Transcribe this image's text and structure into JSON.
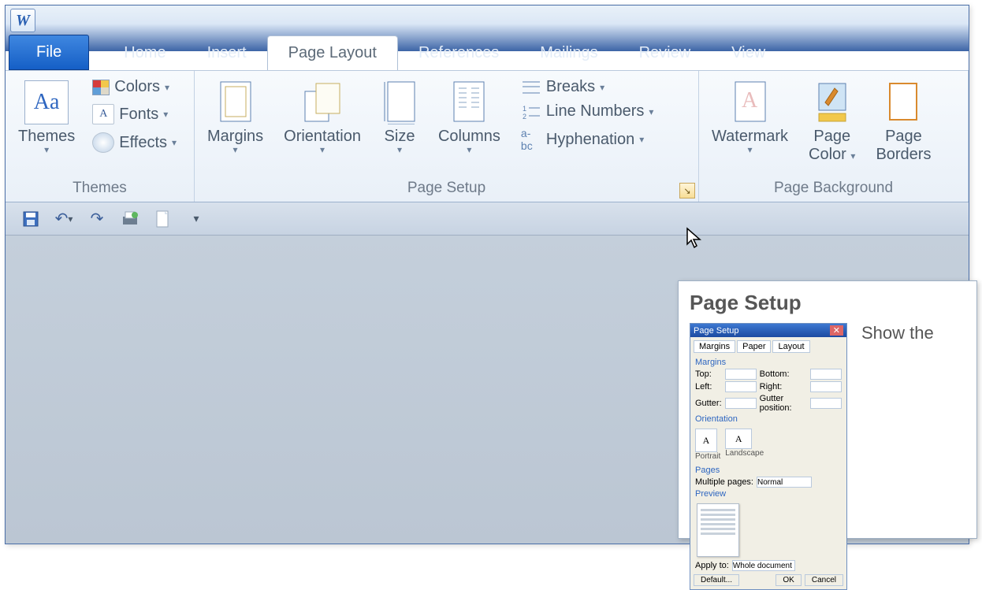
{
  "app_icon_letter": "W",
  "tabs": {
    "file": "File",
    "home": "Home",
    "insert": "Insert",
    "page_layout": "Page Layout",
    "references": "References",
    "mailings": "Mailings",
    "review": "Review",
    "view": "View"
  },
  "groups": {
    "themes": {
      "label": "Themes",
      "themes_btn": "Themes",
      "colors": "Colors",
      "fonts": "Fonts",
      "effects": "Effects"
    },
    "page_setup": {
      "label": "Page Setup",
      "margins": "Margins",
      "orientation": "Orientation",
      "size": "Size",
      "columns": "Columns",
      "breaks": "Breaks",
      "line_numbers": "Line Numbers",
      "hyphenation": "Hyphenation"
    },
    "page_background": {
      "label": "Page Background",
      "watermark": "Watermark",
      "page_color": "Page Color",
      "page_borders": "Page Borders"
    }
  },
  "tooltip": {
    "title": "Page Setup",
    "desc": "Show the",
    "preview": {
      "window_title": "Page Setup",
      "tabs": [
        "Margins",
        "Paper",
        "Layout"
      ],
      "section_margins": "Margins",
      "top": "Top:",
      "bottom": "Bottom:",
      "left": "Left:",
      "right": "Right:",
      "gutter": "Gutter:",
      "gutter_pos": "Gutter position:",
      "section_orientation": "Orientation",
      "portrait": "Portrait",
      "landscape": "Landscape",
      "section_pages": "Pages",
      "multiple": "Multiple pages:",
      "multiple_val": "Normal",
      "section_preview": "Preview",
      "apply_to": "Apply to:",
      "apply_val": "Whole document",
      "default_btn": "Default...",
      "ok": "OK",
      "cancel": "Cancel"
    }
  }
}
